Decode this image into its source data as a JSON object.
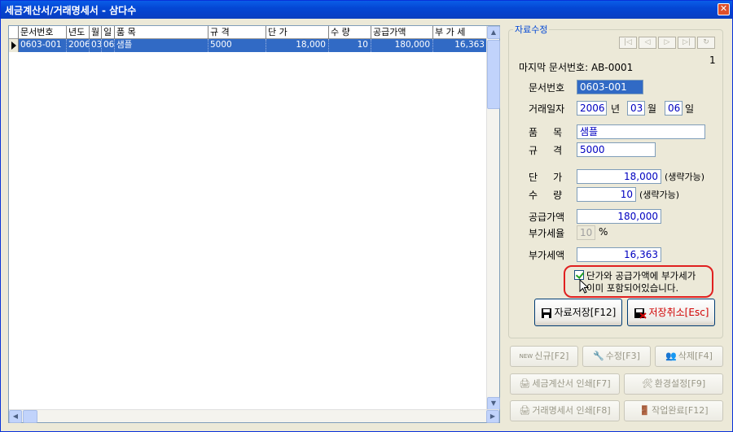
{
  "window": {
    "title": "세금계산서/거래명세서 - 삼다수",
    "close_label": "✕"
  },
  "grid": {
    "columns": [
      "문서번호",
      "년도",
      "월",
      "일",
      "품 목",
      "규 격",
      "단 가",
      "수 량",
      "공급가액",
      "부 가 세"
    ],
    "rows": [
      [
        "0603-001",
        "2006",
        "03",
        "06",
        "샘플",
        "5000",
        "18,000",
        "10",
        "180,000",
        "16,363"
      ]
    ]
  },
  "panel": {
    "group_title": "자료수정",
    "record_count": "1",
    "last_doc": "마지막 문서번호: AB-0001",
    "nav_buttons": [
      "|◁",
      "◁",
      "▷",
      "▷|",
      "↻"
    ],
    "fields": {
      "doc_no_label": "문서번호",
      "doc_no": "0603-001",
      "date_label": "거래일자",
      "year": "2006",
      "year_unit": "년",
      "month": "03",
      "month_unit": "월",
      "day": "06",
      "day_unit": "일",
      "item_label": "품     목",
      "item": "샘플",
      "spec_label": "규     격",
      "spec": "5000",
      "price_label": "단     가",
      "price": "18,000",
      "price_note": "(생략가능)",
      "qty_label": "수     량",
      "qty": "10",
      "qty_note": "(생략가능)",
      "supply_label": "공급가액",
      "supply": "180,000",
      "vat_rate_label": "부가세율",
      "vat_rate": "10",
      "vat_rate_unit": "%",
      "vat_label": "부가세액",
      "vat": "16,363"
    },
    "checkbox": {
      "line1": "단가와 공급가액에 부가세가",
      "line2": "이미 포함되어있습니다.",
      "checked": true
    },
    "save_button": "자료저장[F12]",
    "cancel_button": "저장취소[Esc]"
  },
  "actions": {
    "new": "신규[F2]",
    "new_badge": "NEW",
    "edit": "수정[F3]",
    "delete": "삭제[F4]",
    "print_tax": "세금계산서 인쇄[F7]",
    "settings": "환경설정[F9]",
    "print_statement": "거래명세서 인쇄[F8]",
    "finish": "작업완료[F12]"
  },
  "colors": {
    "title_bar": "#0447d4",
    "selection": "#316ac5",
    "field_text": "#0000c0",
    "cancel_text": "#d00000",
    "highlight_ring": "#e02020"
  }
}
